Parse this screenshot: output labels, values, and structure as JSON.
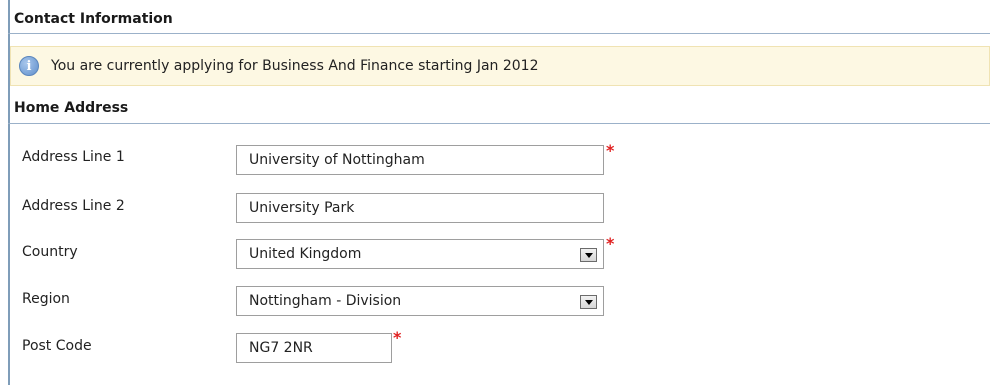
{
  "contact_section": {
    "title": "Contact Information"
  },
  "info_message": "You are currently applying for Business And Finance starting Jan 2012",
  "home_address": {
    "title": "Home Address",
    "fields": {
      "address_line_1": {
        "label": "Address Line 1",
        "value": "University of Nottingham",
        "required": true
      },
      "address_line_2": {
        "label": "Address Line 2",
        "value": "University Park",
        "required": false
      },
      "country": {
        "label": "Country",
        "value": "United Kingdom",
        "required": true
      },
      "region": {
        "label": "Region",
        "value": "Nottingham - Division",
        "required": false
      },
      "post_code": {
        "label": "Post Code",
        "value": "NG7 2NR",
        "required": true
      }
    }
  },
  "required_marker": "*",
  "icons": {
    "info": "info-icon",
    "dropdown": "chevron-down-icon"
  },
  "colors": {
    "info_background": "#fdf8e3",
    "required": "#e02020",
    "header_border": "#9bb1c9"
  }
}
